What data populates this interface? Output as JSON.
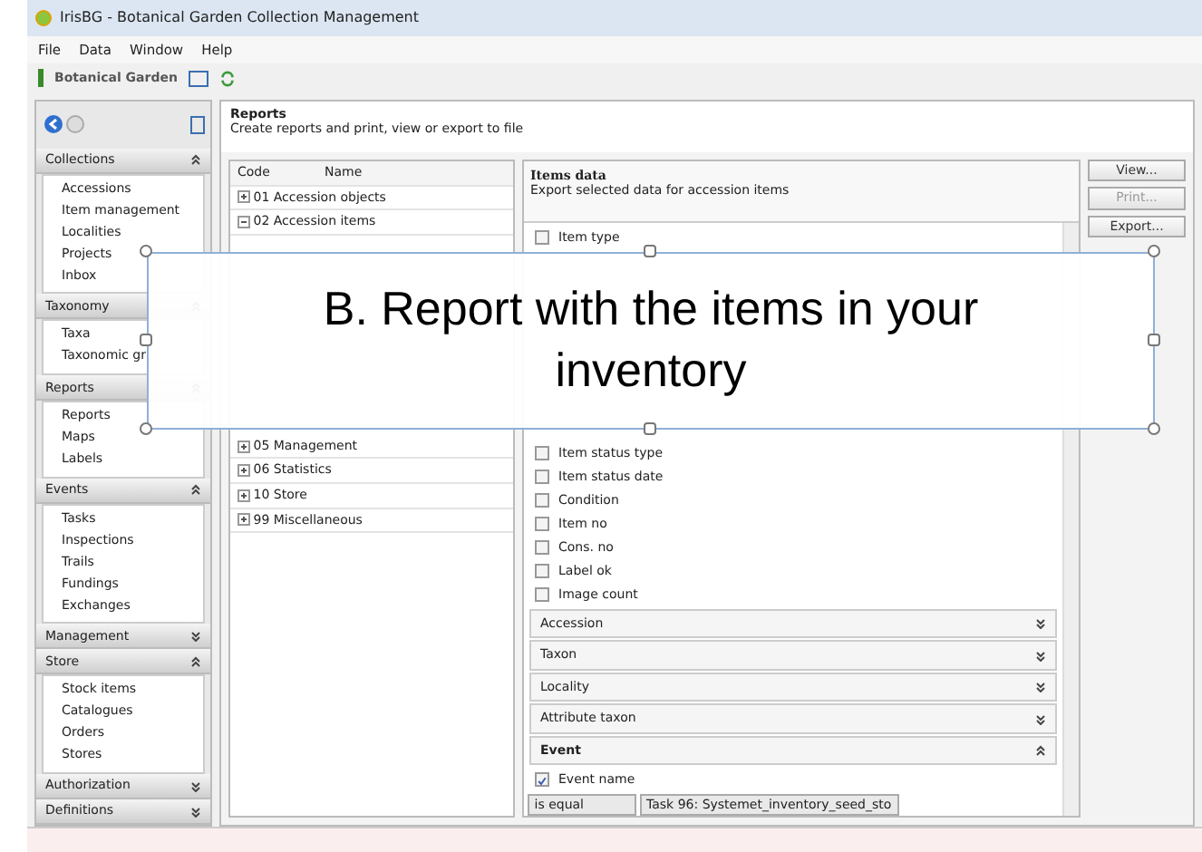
{
  "window": {
    "title": "IrisBG - Botanical Garden Collection Management"
  },
  "menu": [
    "File",
    "Data",
    "Window",
    "Help"
  ],
  "toolbar": {
    "garden": "Botanical Garden"
  },
  "sidebar": {
    "groups": [
      {
        "title": "Collections",
        "expanded": true,
        "items": [
          "Accessions",
          "Item management",
          "Localities",
          "Projects",
          "Inbox"
        ]
      },
      {
        "title": "Taxonomy",
        "expanded": true,
        "items": [
          "Taxa",
          "Taxonomic gr"
        ]
      },
      {
        "title": "Reports",
        "expanded": true,
        "items": [
          "Reports",
          "Maps",
          "Labels"
        ]
      },
      {
        "title": "Events",
        "expanded": true,
        "items": [
          "Tasks",
          "Inspections",
          "Trails",
          "Fundings",
          "Exchanges"
        ]
      },
      {
        "title": "Management",
        "expanded": false
      },
      {
        "title": "Store",
        "expanded": true,
        "items": [
          "Stock items",
          "Catalogues",
          "Orders",
          "Stores"
        ]
      },
      {
        "title": "Authorization",
        "expanded": false
      },
      {
        "title": "Definitions",
        "expanded": false
      }
    ]
  },
  "header": {
    "title": "Reports",
    "subtitle": "Create reports and print, view or export to file"
  },
  "tree": {
    "columns": [
      "Code",
      "Name"
    ],
    "rows": [
      {
        "label": "01 Accession objects",
        "expanded": false
      },
      {
        "label": "02 Accession items",
        "expanded": true
      },
      {
        "label": "05 Management",
        "expanded": false
      },
      {
        "label": "06 Statistics",
        "expanded": false
      },
      {
        "label": "10 Store",
        "expanded": false
      },
      {
        "label": "99 Miscellaneous",
        "expanded": false
      }
    ]
  },
  "detail": {
    "title": "Items data",
    "subtitle": "Export selected data for accession items",
    "fields": [
      {
        "kind": "check",
        "label": "Item type",
        "checked": false
      },
      {
        "kind": "check",
        "label": "Item status type",
        "checked": false
      },
      {
        "kind": "check",
        "label": "Item status date",
        "checked": false
      },
      {
        "kind": "check",
        "label": "Condition",
        "checked": false
      },
      {
        "kind": "check",
        "label": "Item no",
        "checked": false
      },
      {
        "kind": "check",
        "label": "Cons. no",
        "checked": false
      },
      {
        "kind": "check",
        "label": "Label ok",
        "checked": false
      },
      {
        "kind": "check",
        "label": "Image count",
        "checked": false
      },
      {
        "kind": "section",
        "label": "Accession",
        "expanded": false
      },
      {
        "kind": "section",
        "label": "Taxon",
        "expanded": false
      },
      {
        "kind": "section",
        "label": "Locality",
        "expanded": false
      },
      {
        "kind": "section",
        "label": "Attribute taxon",
        "expanded": false
      },
      {
        "kind": "section",
        "label": "Event",
        "expanded": true
      },
      {
        "kind": "check",
        "label": "Event name",
        "checked": true
      },
      {
        "kind": "filter",
        "operator": "is equal",
        "value": "Task 96: Systemet_inventory_seed_sto"
      }
    ]
  },
  "buttons": [
    {
      "label": "View...",
      "disabled": false
    },
    {
      "label": "Print...",
      "disabled": true
    },
    {
      "label": "Export...",
      "disabled": false
    }
  ],
  "overlay": {
    "text": "B. Report with the items in your inventory"
  }
}
